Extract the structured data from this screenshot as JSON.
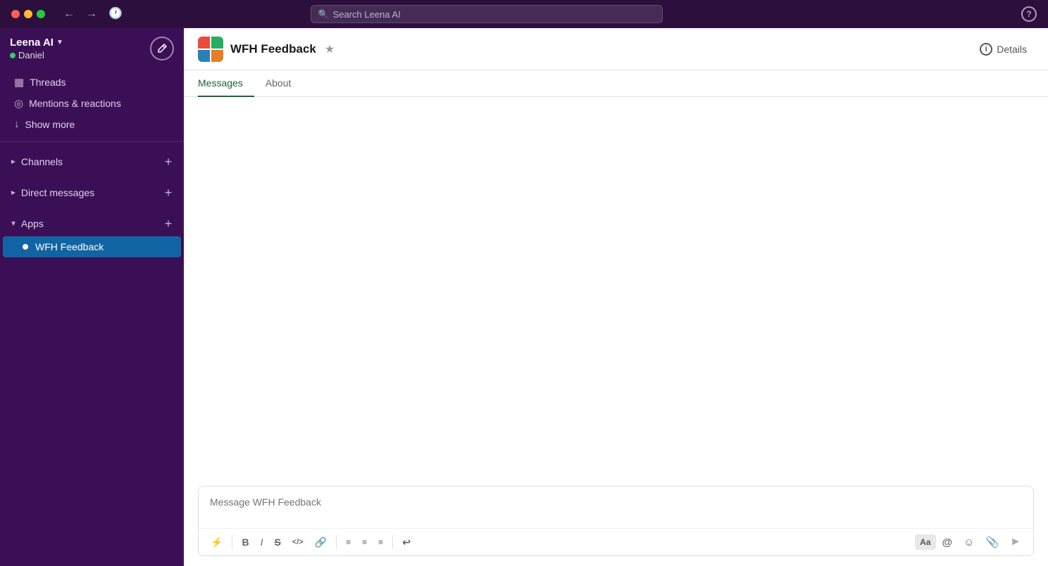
{
  "titlebar": {
    "search_placeholder": "Search Leena AI",
    "help_label": "?"
  },
  "sidebar": {
    "workspace_name": "Leena AI",
    "user_name": "Daniel",
    "nav_items": [
      {
        "id": "threads",
        "label": "Threads",
        "icon": "⊟"
      },
      {
        "id": "mentions",
        "label": "Mentions & reactions",
        "icon": "◎"
      },
      {
        "id": "show-more",
        "label": "Show more",
        "icon": "↓"
      }
    ],
    "sections": [
      {
        "id": "channels",
        "label": "Channels",
        "collapsed": true
      },
      {
        "id": "direct-messages",
        "label": "Direct messages",
        "collapsed": true
      },
      {
        "id": "apps",
        "label": "Apps",
        "collapsed": false
      }
    ],
    "apps": [
      {
        "id": "wfh-feedback",
        "label": "WFH Feedback",
        "active": true
      }
    ]
  },
  "channel": {
    "name": "WFH Feedback",
    "details_label": "Details"
  },
  "tabs": [
    {
      "id": "messages",
      "label": "Messages",
      "active": true
    },
    {
      "id": "about",
      "label": "About",
      "active": false
    }
  ],
  "message_input": {
    "placeholder": "Message WFH Feedback"
  },
  "toolbar": {
    "buttons": [
      {
        "id": "lightning",
        "label": "⚡",
        "title": "Shortcuts"
      },
      {
        "id": "bold",
        "label": "B",
        "title": "Bold"
      },
      {
        "id": "italic",
        "label": "I",
        "title": "Italic"
      },
      {
        "id": "strikethrough",
        "label": "S̶",
        "title": "Strikethrough"
      },
      {
        "id": "code",
        "label": "</>",
        "title": "Inline code"
      },
      {
        "id": "link",
        "label": "🔗",
        "title": "Link"
      },
      {
        "id": "ordered-list",
        "label": "≡",
        "title": "Ordered list"
      },
      {
        "id": "unordered-list",
        "label": "≡",
        "title": "Unordered list"
      },
      {
        "id": "block-quote",
        "label": "≡",
        "title": "Block quote"
      },
      {
        "id": "history",
        "label": "↩",
        "title": "Undo/Redo"
      }
    ],
    "right_buttons": [
      {
        "id": "format",
        "label": "Aa",
        "title": "Format"
      },
      {
        "id": "mention",
        "label": "@",
        "title": "Mention"
      },
      {
        "id": "emoji",
        "label": "☺",
        "title": "Emoji"
      },
      {
        "id": "attach",
        "label": "📎",
        "title": "Attach"
      },
      {
        "id": "send",
        "label": "➤",
        "title": "Send"
      }
    ]
  },
  "colors": {
    "sidebar_bg": "#3b0f55",
    "active_item": "#1164a3",
    "active_tab": "#1d6332"
  }
}
